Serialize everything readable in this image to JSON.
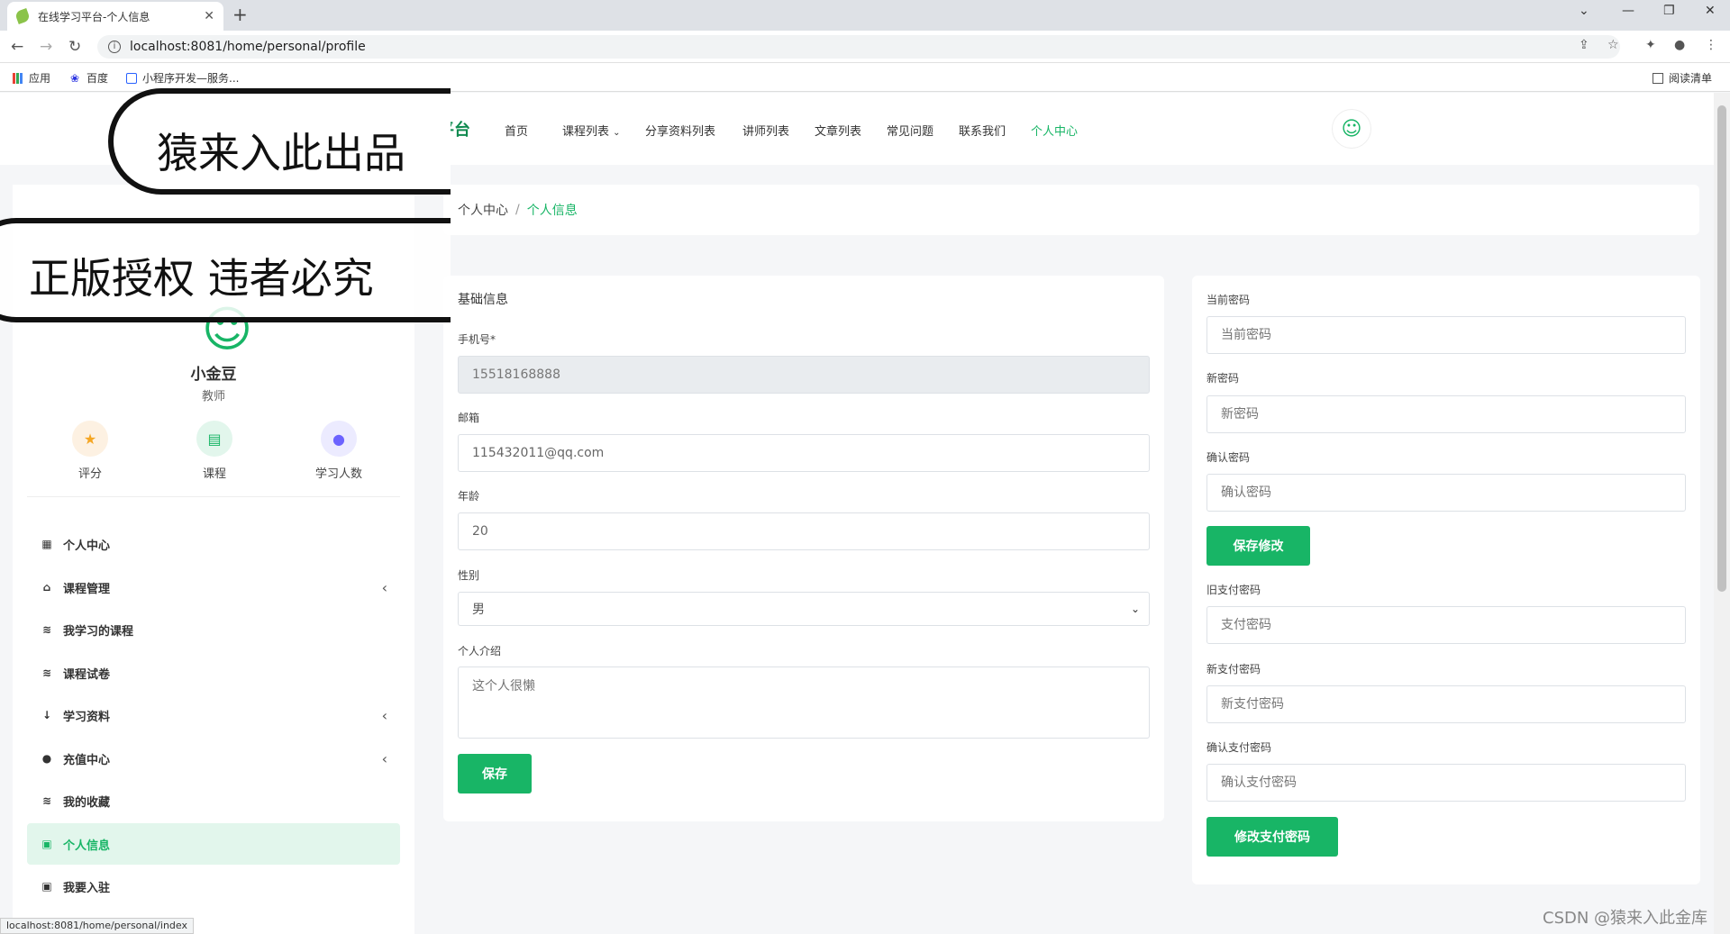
{
  "browser": {
    "tab_title": "在线学习平台-个人信息",
    "url": "localhost:8081/home/personal/profile",
    "bookmarks": [
      "应用",
      "百度",
      "小程序开发—服务..."
    ],
    "reading_list": "阅读清单",
    "status_url": "localhost:8081/home/personal/index"
  },
  "header": {
    "logo_text": "在线学习平台",
    "nav": [
      "首页",
      "课程列表",
      "分享资料列表",
      "讲师列表",
      "文章列表",
      "常见问题",
      "联系我们",
      "个人中心"
    ]
  },
  "sidebar": {
    "user_name": "小金豆",
    "user_role": "教师",
    "stats": [
      {
        "label": "评分",
        "icon": "star-icon",
        "color": "#f5a623"
      },
      {
        "label": "课程",
        "icon": "document-icon",
        "color": "#18b566"
      },
      {
        "label": "学习人数",
        "icon": "user-icon",
        "color": "#6c63ff"
      }
    ],
    "menu": [
      {
        "label": "个人中心",
        "icon": "grid-icon"
      },
      {
        "label": "课程管理",
        "icon": "basket-icon"
      },
      {
        "label": "我学习的课程",
        "icon": "layers-icon"
      },
      {
        "label": "课程试卷",
        "icon": "layers-icon"
      },
      {
        "label": "学习资料",
        "icon": "sort-icon"
      },
      {
        "label": "充值中心",
        "icon": "user-icon"
      },
      {
        "label": "我的收藏",
        "icon": "layers-icon"
      },
      {
        "label": "个人信息",
        "icon": "id-card-icon"
      },
      {
        "label": "我要入驻",
        "icon": "id-card-icon"
      }
    ]
  },
  "breadcrumb": {
    "root": "个人中心",
    "separator": "/",
    "current": "个人信息"
  },
  "basic_info": {
    "title": "基础信息",
    "phone_label": "手机号*",
    "phone_value": "15518168888",
    "email_label": "邮箱",
    "email_value": "115432011@qq.com",
    "age_label": "年龄",
    "age_value": "20",
    "gender_label": "性别",
    "gender_value": "男",
    "intro_label": "个人介绍",
    "intro_value": "这个人很懒",
    "save_label": "保存"
  },
  "password": {
    "current_label": "当前密码",
    "current_placeholder": "当前密码",
    "new_label": "新密码",
    "new_placeholder": "新密码",
    "confirm_label": "确认密码",
    "confirm_placeholder": "确认密码",
    "save_label": "保存修改",
    "old_pay_label": "旧支付密码",
    "old_pay_placeholder": "支付密码",
    "new_pay_label": "新支付密码",
    "new_pay_placeholder": "新支付密码",
    "confirm_pay_label": "确认支付密码",
    "confirm_pay_placeholder": "确认支付密码",
    "pay_save_label": "修改支付密码"
  },
  "watermarks": {
    "line1": "猿来入此出品",
    "line2": "正版授权 违者必究",
    "csdn": "CSDN @猿来入此金库"
  },
  "colors": {
    "accent": "#18b566",
    "logo": "#0f8a4f"
  }
}
